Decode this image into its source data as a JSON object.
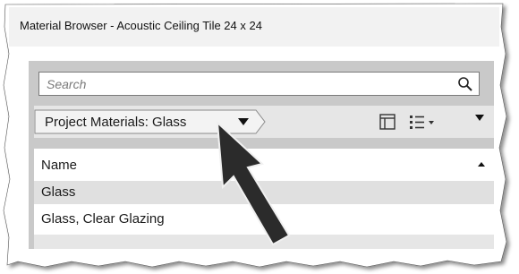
{
  "window": {
    "title": "Material Browser - Acoustic Ceiling Tile 24 x 24"
  },
  "search": {
    "placeholder": "Search",
    "icon": "search-icon"
  },
  "toolbar": {
    "breadcrumb_label": "Project Materials: Glass",
    "breadcrumb_icon": "caret-down-icon",
    "view_icon": "panel-view-icon",
    "list_icon": "list-options-icon"
  },
  "list": {
    "column_header": "Name",
    "sort_icon": "sort-ascending-icon",
    "items": [
      {
        "label": "Glass"
      },
      {
        "label": "Glass, Clear Glazing"
      }
    ]
  },
  "annotation": {
    "icon": "pointer-arrow-icon"
  },
  "colors": {
    "panel_bg": "#c9c9c9",
    "selected_row": "#e0e0e0",
    "arrow": "#2b2b2b"
  }
}
